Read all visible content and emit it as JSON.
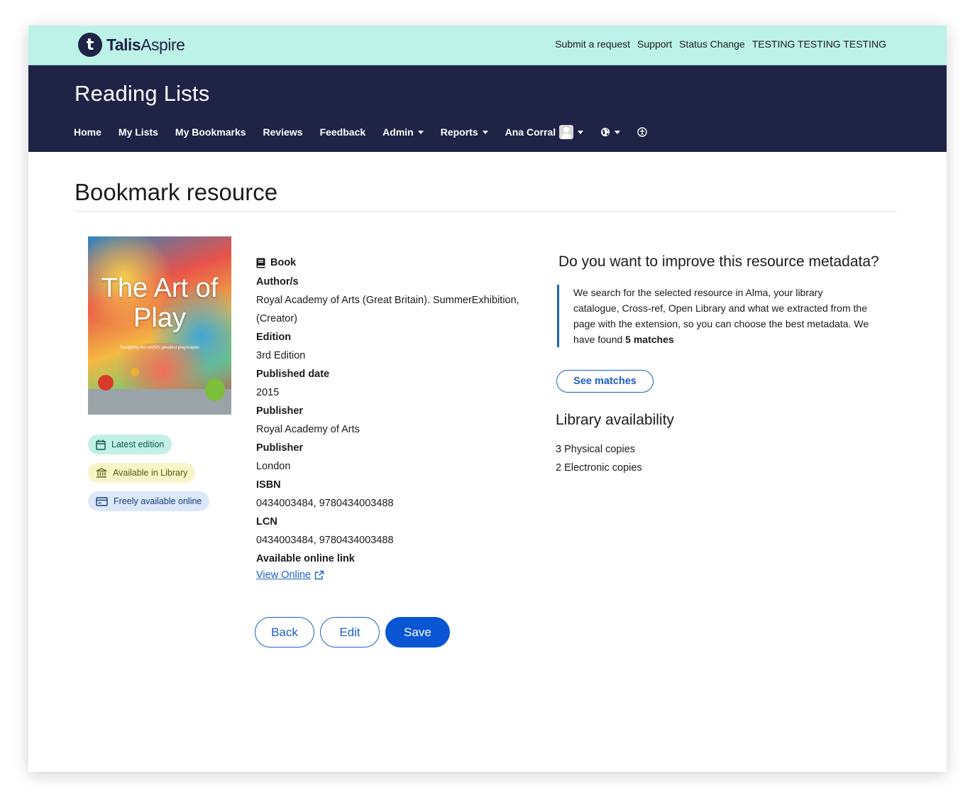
{
  "brand": {
    "name_bold": "Talis",
    "name_light": "Aspire",
    "mark": "t"
  },
  "toplinks": [
    "Submit a request",
    "Support",
    "Status Change",
    "TESTING TESTING TESTING"
  ],
  "header": {
    "title": "Reading Lists",
    "nav": {
      "home": "Home",
      "my_lists": "My Lists",
      "my_bookmarks": "My Bookmarks",
      "reviews": "Reviews",
      "feedback": "Feedback",
      "admin": "Admin",
      "reports": "Reports",
      "user": "Ana Corral"
    }
  },
  "page": {
    "title": "Bookmark resource"
  },
  "cover": {
    "title": "The Art of Play",
    "subtitle": "Designing the world's greatest playscapes"
  },
  "badges": {
    "latest": "Latest edition",
    "library": "Available in Library",
    "online": "Freely available online"
  },
  "resource": {
    "type": "Book",
    "fields": [
      {
        "label": "Author/s",
        "value": "Royal Academy of Arts (Great Britain). SummerExhibition, (Creator)"
      },
      {
        "label": "Edition",
        "value": "3rd Edition"
      },
      {
        "label": "Published date",
        "value": "2015"
      },
      {
        "label": "Publisher",
        "value": "Royal Academy of Arts"
      },
      {
        "label": "Publisher",
        "value": "London"
      },
      {
        "label": "ISBN",
        "value": "0434003484, 9780434003488"
      },
      {
        "label": "LCN",
        "value": "0434003484, 9780434003488"
      }
    ],
    "online_label": "Available online link",
    "online_link": "View Online"
  },
  "actions": {
    "back": "Back",
    "edit": "Edit",
    "save": "Save"
  },
  "improve": {
    "title": "Do you want to improve this resource metadata?",
    "text": "We search for the selected resource in Alma, your library catalogue, Cross-ref, Open Library and what we extracted from the page with the extension, so you can choose the best metadata. We have found ",
    "matches": "5 matches",
    "button": "See matches"
  },
  "availability": {
    "title": "Library availability",
    "items": [
      "3 Physical copies",
      "2 Electronic copies"
    ]
  },
  "colors": {
    "topbar": "#bdf2e8",
    "header": "#1f2346",
    "primary": "#0a55d4",
    "link": "#1d5fc6"
  }
}
